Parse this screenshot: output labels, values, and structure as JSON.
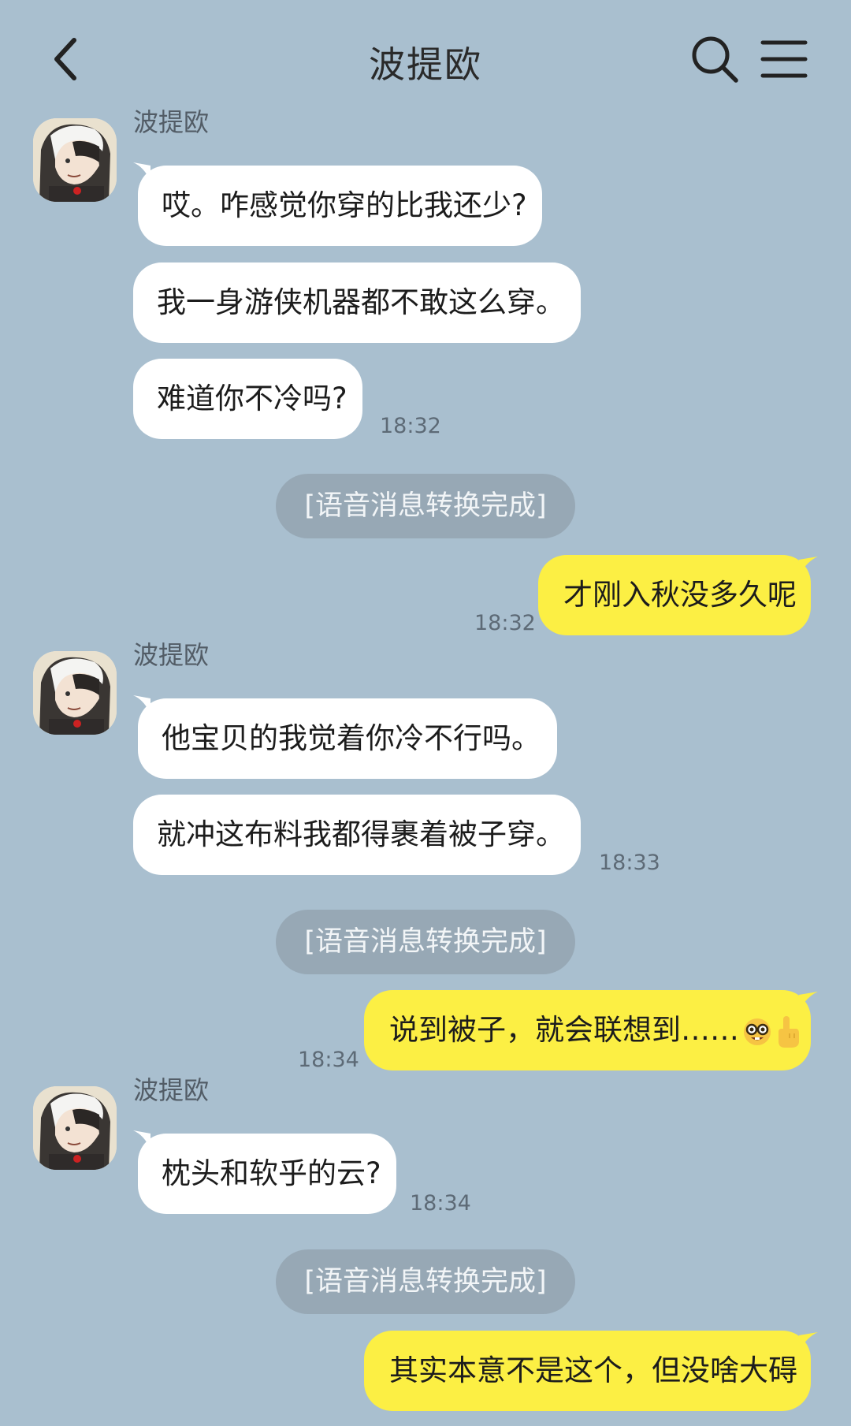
{
  "header": {
    "title": "波提欧"
  },
  "colors": {
    "background": "#a9bfcf",
    "bubble_incoming": "#ffffff",
    "bubble_outgoing": "#fcef44",
    "system_pill": "#97a8b5"
  },
  "icons": {
    "back": "chevron-left-icon",
    "search": "search-icon",
    "menu": "menu-icon"
  },
  "conversation": {
    "group1": {
      "sender": "波提欧",
      "messages": [
        "哎。咋感觉你穿的比我还少?",
        "我一身游侠机器都不敢这么穿。",
        "难道你不冷吗?"
      ],
      "time": "18:32"
    },
    "system1": "[语音消息转换完成]",
    "out1": {
      "text": "才刚入秋没多久呢",
      "time": "18:32"
    },
    "group2": {
      "sender": "波提欧",
      "messages": [
        "他宝贝的我觉着你冷不行吗。",
        "就冲这布料我都得裹着被子穿。"
      ],
      "time": "18:33"
    },
    "system2": "[语音消息转换完成]",
    "out2": {
      "text": "说到被子，就会联想到……",
      "emojis": [
        "nerd-face-emoji",
        "pointing-up-emoji"
      ],
      "time": "18:34"
    },
    "group3": {
      "sender": "波提欧",
      "messages": [
        "枕头和软乎的云?"
      ],
      "time": "18:34"
    },
    "system3": "[语音消息转换完成]",
    "out3": {
      "text": "其实本意不是这个，但没啥大碍"
    }
  }
}
